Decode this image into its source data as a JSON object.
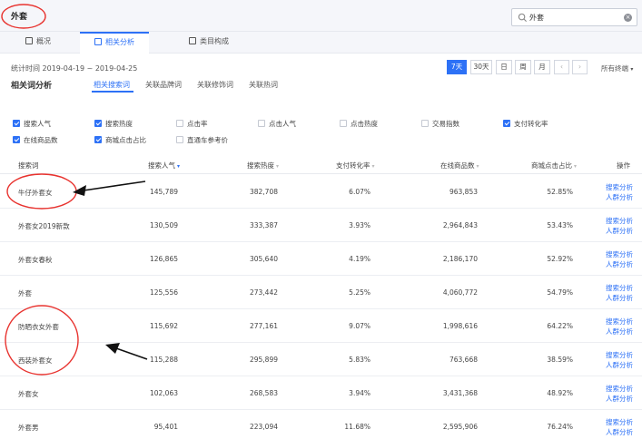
{
  "header": {
    "keyword": "外套",
    "search_value": "外套"
  },
  "tabs": [
    {
      "label": "概况"
    },
    {
      "label": "相关分析"
    },
    {
      "label": "类目构成"
    }
  ],
  "stats": {
    "period": "统计时间 2019-04-19 ~ 2019-04-25",
    "ranges": [
      "7天",
      "30天",
      "日",
      "周",
      "月"
    ],
    "prev": "‹",
    "next": "›",
    "terminal": "所有终端"
  },
  "section": {
    "title": "相关词分析",
    "subtabs": [
      "相关搜索词",
      "关联品牌词",
      "关联修饰词",
      "关联热词"
    ]
  },
  "metrics": [
    {
      "label": "搜索人气",
      "checked": true
    },
    {
      "label": "搜索热度",
      "checked": true
    },
    {
      "label": "点击率",
      "checked": false
    },
    {
      "label": "点击人气",
      "checked": false
    },
    {
      "label": "点击热度",
      "checked": false
    },
    {
      "label": "交易指数",
      "checked": false
    },
    {
      "label": "支付转化率",
      "checked": true
    },
    {
      "label": "在线商品数",
      "checked": true
    },
    {
      "label": "商城点击占比",
      "checked": true
    },
    {
      "label": "直通车参考价",
      "checked": false
    }
  ],
  "table": {
    "headers": [
      "搜索词",
      "搜索人气",
      "搜索热度",
      "支付转化率",
      "在线商品数",
      "商城点击占比",
      "操作"
    ],
    "sort_icon": "▾",
    "rows": [
      {
        "term": "牛仔外套女",
        "pop": "145,789",
        "heat": "382,708",
        "conv": "6.07%",
        "items": "963,853",
        "mall": "52.85%"
      },
      {
        "term": "外套女2019新款",
        "pop": "130,509",
        "heat": "333,387",
        "conv": "3.93%",
        "items": "2,964,843",
        "mall": "53.43%"
      },
      {
        "term": "外套女春秋",
        "pop": "126,865",
        "heat": "305,640",
        "conv": "4.19%",
        "items": "2,186,170",
        "mall": "52.92%"
      },
      {
        "term": "外套",
        "pop": "125,556",
        "heat": "273,442",
        "conv": "5.25%",
        "items": "4,060,772",
        "mall": "54.79%"
      },
      {
        "term": "防晒衣女外套",
        "pop": "115,692",
        "heat": "277,161",
        "conv": "9.07%",
        "items": "1,998,616",
        "mall": "64.22%"
      },
      {
        "term": "西装外套女",
        "pop": "115,288",
        "heat": "295,899",
        "conv": "5.83%",
        "items": "763,668",
        "mall": "38.59%"
      },
      {
        "term": "外套女",
        "pop": "102,063",
        "heat": "268,583",
        "conv": "3.94%",
        "items": "3,431,368",
        "mall": "48.92%"
      },
      {
        "term": "外套男",
        "pop": "95,401",
        "heat": "223,094",
        "conv": "11.68%",
        "items": "2,595,906",
        "mall": "76.24%"
      }
    ],
    "op_labels": [
      "搜索分析",
      "人群分析"
    ]
  },
  "colors": {
    "accent": "#2d71f6",
    "annotation": "#e8332f"
  }
}
